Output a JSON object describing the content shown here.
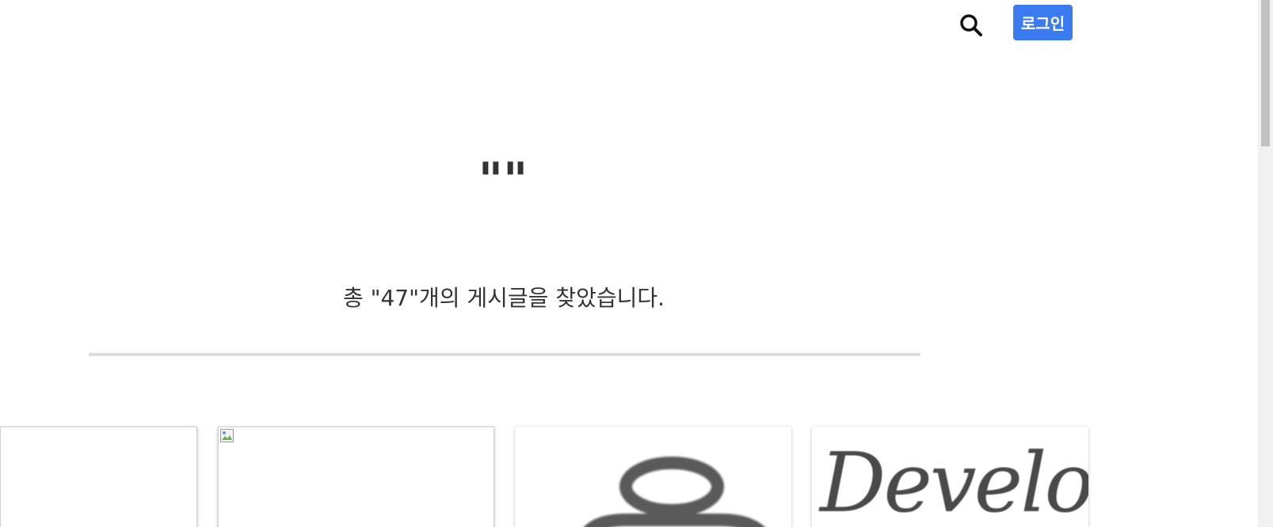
{
  "header": {
    "search_icon": "search-icon",
    "login_label": "로그인",
    "accent_color": "#3a7bf2"
  },
  "search": {
    "query_display": "\"\"",
    "result_summary": "총 \"47\"개의 게시글을 찾았습니다."
  },
  "cards": [
    {
      "thumbnail": "blank"
    },
    {
      "thumbnail": "broken-image-icon"
    },
    {
      "thumbnail": "user-avatar-icon"
    },
    {
      "thumbnail_text": "Develog"
    }
  ]
}
